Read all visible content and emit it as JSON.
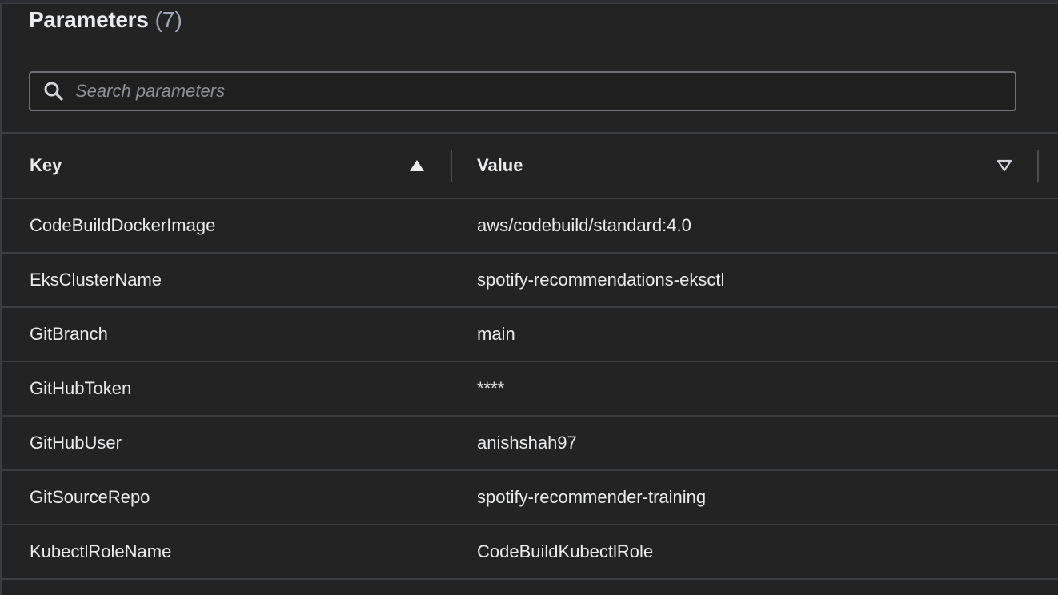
{
  "header": {
    "title": "Parameters",
    "count": "(7)"
  },
  "search": {
    "placeholder": "Search parameters",
    "value": ""
  },
  "table": {
    "columns": [
      {
        "label": "Key",
        "sort_icon": "sort-ascending-filled-triangle-icon"
      },
      {
        "label": "Value",
        "sort_icon": "sort-descending-outline-triangle-icon"
      }
    ],
    "rows": [
      {
        "key": "CodeBuildDockerImage",
        "value": "aws/codebuild/standard:4.0"
      },
      {
        "key": "EksClusterName",
        "value": "spotify-recommendations-eksctl"
      },
      {
        "key": "GitBranch",
        "value": "main"
      },
      {
        "key": "GitHubToken",
        "value": "****"
      },
      {
        "key": "GitHubUser",
        "value": "anishshah97"
      },
      {
        "key": "GitSourceRepo",
        "value": "spotify-recommender-training"
      },
      {
        "key": "KubectlRoleName",
        "value": "CodeBuildKubectlRole"
      }
    ]
  },
  "colors": {
    "background": "#232323",
    "text": "#e9ebed",
    "muted": "#9ba7b6",
    "border": "#3a3d40"
  }
}
